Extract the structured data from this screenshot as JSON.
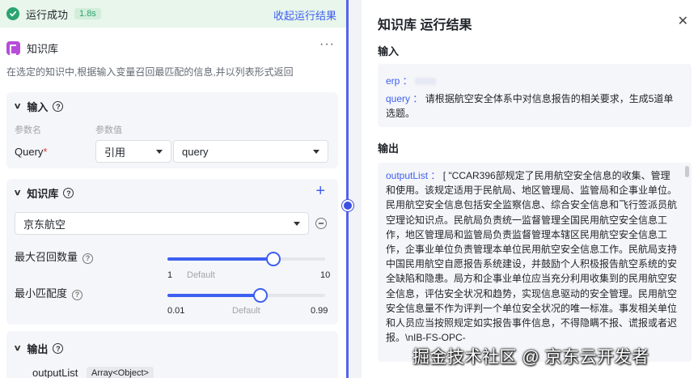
{
  "status": {
    "text": "运行成功",
    "time": "1.8s",
    "collapse_label": "收起运行结果"
  },
  "node": {
    "title": "知识库",
    "more": "···",
    "description": "在选定的知识中,根据输入变量召回最匹配的信息,并以列表形式返回"
  },
  "input_section": {
    "title": "输入",
    "param_name_header": "参数名",
    "param_value_header": "参数值",
    "param_name": "Query",
    "required_mark": "*",
    "value_type": "引用",
    "value_ref": "query"
  },
  "kb_section": {
    "title": "知识库",
    "add_symbol": "+",
    "selected_kb": "京东航空",
    "max_recall": {
      "label": "最大召回数量",
      "value": 7,
      "fraction": 0.67,
      "min_label": "1",
      "default_label": "Default",
      "max_label": "10"
    },
    "min_match": {
      "label": "最小匹配度",
      "value_fraction": 0.59,
      "min_label": "0.01",
      "default_label": "Default",
      "max_label": "0.99"
    }
  },
  "output_section": {
    "title": "输出",
    "var_name": "outputList",
    "var_type": "Array<Object>"
  },
  "result_panel": {
    "title": "知识库 运行结果",
    "close_symbol": "✕",
    "input_label": "输入",
    "erp_key": "erp",
    "query_key": "query",
    "query_value": "请根据航空安全体系中对信息报告的相关要求，生成5道单选题。",
    "output_label": "输出",
    "output_key": "outputList",
    "output_value": "[ \"CCAR396部规定了民用航空安全信息的收集、管理和使用。该规定适用于民航局、地区管理局、监管局和企事业单位。民用航空安全信息包括安全监察信息、综合安全信息和飞行签派员航空理论知识点。民航局负责统一监督管理全国民用航空安全信息工作，地区管理局和监管局负责监督管理本辖区民用航空安全信息工作，企事业单位负责管理本单位民用航空安全信息工作。民航局支持中国民用航空自愿报告系统建设，并鼓励个人积极报告航空系统的安全缺陷和隐患。局方和企事业单位应当充分利用收集到的民用航空安全信息，评估安全状况和趋势，实现信息驱动的安全管理。民用航空安全信息量不作为评判一个单位安全状况的唯一标准。事发相关单位和人员应当按照规定如实报告事件信息，不得隐瞒不报、谎报或者迟报。\\nIB-FS-OPC-"
  },
  "watermark": "掘金技术社区 @ 京东云开发者",
  "colors": {
    "accent": "#3d5ff0",
    "success": "#2ba471",
    "kb_icon": "#b64cd8"
  }
}
